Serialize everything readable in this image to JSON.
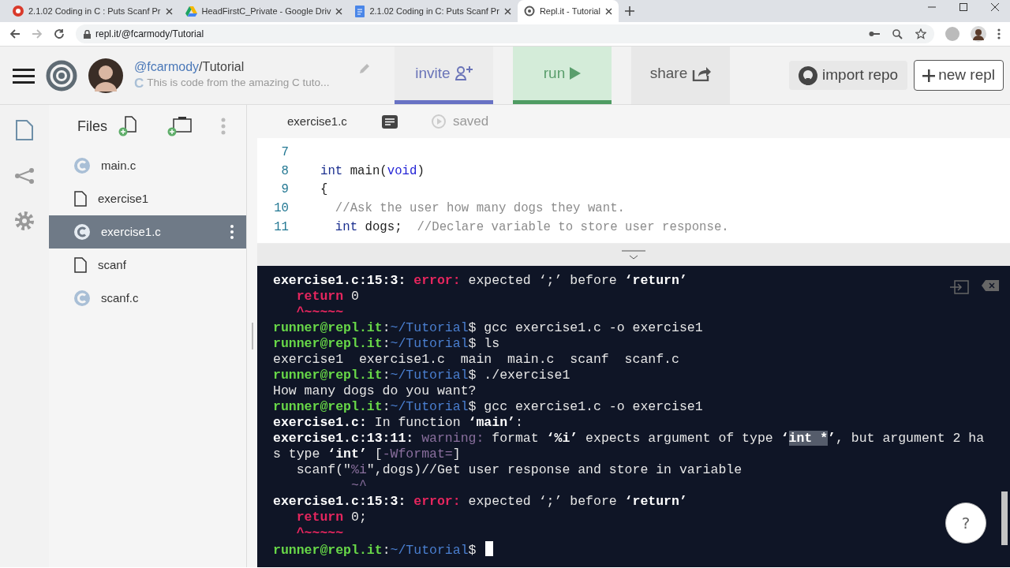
{
  "browser": {
    "tabs": [
      {
        "title": "2.1.02 Coding in C : Puts Scanf Pr",
        "kind": "red",
        "selected": false
      },
      {
        "title": "HeadFirstC_Private - Google Driv",
        "kind": "drive",
        "selected": false
      },
      {
        "title": "2.1.02 Coding in C: Puts Scanf Pr",
        "kind": "doc",
        "selected": false
      },
      {
        "title": "Repl.it - Tutorial",
        "kind": "repl",
        "selected": true
      }
    ],
    "url": "repl.it/@fcarmody/Tutorial"
  },
  "header": {
    "user": "@fcarmody",
    "repl": "/Tutorial",
    "description": "This is code from the amazing C tuto...",
    "language": "C",
    "actions": [
      {
        "label": "invite",
        "kind": "invite"
      },
      {
        "label": "run",
        "kind": "run"
      },
      {
        "label": "share",
        "kind": "share"
      }
    ],
    "import_repo": "import repo",
    "new_repl": "new repl"
  },
  "files": {
    "title": "Files",
    "items": [
      {
        "name": "main.c",
        "kind": "c",
        "selected": false
      },
      {
        "name": "exercise1",
        "kind": "file",
        "selected": false
      },
      {
        "name": "exercise1.c",
        "kind": "c",
        "selected": true
      },
      {
        "name": "scanf",
        "kind": "file",
        "selected": false
      },
      {
        "name": "scanf.c",
        "kind": "c",
        "selected": false
      }
    ]
  },
  "editor": {
    "tab": "exercise1.c",
    "status": "saved",
    "lines": [
      {
        "number": "7"
      },
      {
        "number": "8",
        "segments": [
          {
            "text": "int",
            "kind": "type"
          },
          {
            "text": " main(",
            "kind": "plain"
          },
          {
            "text": "void",
            "kind": "kw"
          },
          {
            "text": ")",
            "kind": "plain"
          }
        ]
      },
      {
        "number": "9",
        "segments": [
          {
            "text": "{",
            "kind": "plain"
          }
        ]
      },
      {
        "number": "10",
        "segments": [
          {
            "text": "  //Ask the user how many dogs they want.",
            "kind": "comment"
          }
        ]
      },
      {
        "number": "11",
        "segments": [
          {
            "text": "  int",
            "kind": "type"
          },
          {
            "text": " dogs;  ",
            "kind": "plain"
          },
          {
            "text": "//Declare variable to store user response.",
            "kind": "comment"
          }
        ]
      }
    ]
  },
  "terminal": {
    "lines": [
      [
        {
          "text": "exercise1.c:15:3: ",
          "kind": "bold"
        },
        {
          "text": "error:",
          "kind": "err"
        },
        {
          "text": " expected ‘;’ before ",
          "kind": "plain"
        },
        {
          "text": "‘return’",
          "kind": "bold"
        }
      ],
      [
        {
          "text": "   return",
          "kind": "err"
        },
        {
          "text": " 0",
          "kind": "plain"
        }
      ],
      [
        {
          "text": "   ^~~~~~",
          "kind": "err"
        }
      ],
      [
        {
          "text": "runner@repl.it",
          "kind": "prompt"
        },
        {
          "text": ":",
          "kind": "plain"
        },
        {
          "text": "~/Tutorial",
          "kind": "path"
        },
        {
          "text": "$ gcc exercise1.c -o exercise1",
          "kind": "plain"
        }
      ],
      [
        {
          "text": "runner@repl.it",
          "kind": "prompt"
        },
        {
          "text": ":",
          "kind": "plain"
        },
        {
          "text": "~/Tutorial",
          "kind": "path"
        },
        {
          "text": "$ ls",
          "kind": "plain"
        }
      ],
      [
        {
          "text": "exercise1  exercise1.c  main  main.c  scanf  scanf.c",
          "kind": "plain"
        }
      ],
      [
        {
          "text": "runner@repl.it",
          "kind": "prompt"
        },
        {
          "text": ":",
          "kind": "plain"
        },
        {
          "text": "~/Tutorial",
          "kind": "path"
        },
        {
          "text": "$ ./exercise1",
          "kind": "plain"
        }
      ],
      [
        {
          "text": "How many dogs do you want?",
          "kind": "plain"
        }
      ],
      [
        {
          "text": "runner@repl.it",
          "kind": "prompt"
        },
        {
          "text": ":",
          "kind": "plain"
        },
        {
          "text": "~/Tutorial",
          "kind": "path"
        },
        {
          "text": "$ gcc exercise1.c -o exercise1",
          "kind": "plain"
        }
      ],
      [
        {
          "text": "exercise1.c:",
          "kind": "bold"
        },
        {
          "text": " In function ",
          "kind": "plain"
        },
        {
          "text": "‘main’",
          "kind": "bold"
        },
        {
          "text": ":",
          "kind": "plain"
        }
      ],
      [
        {
          "text": "exercise1.c:13:11: ",
          "kind": "bold"
        },
        {
          "text": "warning:",
          "kind": "warn"
        },
        {
          "text": " format ",
          "kind": "plain"
        },
        {
          "text": "‘%i’",
          "kind": "bold"
        },
        {
          "text": " expects argument of type ",
          "kind": "plain"
        },
        {
          "text": "‘",
          "kind": "bold"
        },
        {
          "text": "int *",
          "kind": "sel"
        },
        {
          "text": "’",
          "kind": "bold"
        },
        {
          "text": ", but argument 2 ha",
          "kind": "plain"
        }
      ],
      [
        {
          "text": "s type ",
          "kind": "plain"
        },
        {
          "text": "‘int’",
          "kind": "bold"
        },
        {
          "text": " [",
          "kind": "plain"
        },
        {
          "text": "-Wformat=",
          "kind": "warn"
        },
        {
          "text": "]",
          "kind": "plain"
        }
      ],
      [
        {
          "text": "   scanf(\"",
          "kind": "plain"
        },
        {
          "text": "%i",
          "kind": "warn"
        },
        {
          "text": "\",dogs)//Get user response and store in variable",
          "kind": "plain"
        }
      ],
      [
        {
          "text": "          ~^",
          "kind": "warn"
        }
      ],
      [
        {
          "text": "exercise1.c:15:3: ",
          "kind": "bold"
        },
        {
          "text": "error:",
          "kind": "err"
        },
        {
          "text": " expected ‘;’ before ",
          "kind": "plain"
        },
        {
          "text": "‘return’",
          "kind": "bold"
        }
      ],
      [
        {
          "text": "   return",
          "kind": "err"
        },
        {
          "text": " 0;",
          "kind": "plain"
        }
      ],
      [
        {
          "text": "   ^~~~~~",
          "kind": "err"
        }
      ],
      [
        {
          "text": "runner@repl.it",
          "kind": "prompt"
        },
        {
          "text": ":",
          "kind": "plain"
        },
        {
          "text": "~/Tutorial",
          "kind": "path"
        },
        {
          "text": "$ ",
          "kind": "plain"
        }
      ]
    ],
    "help": "?"
  }
}
